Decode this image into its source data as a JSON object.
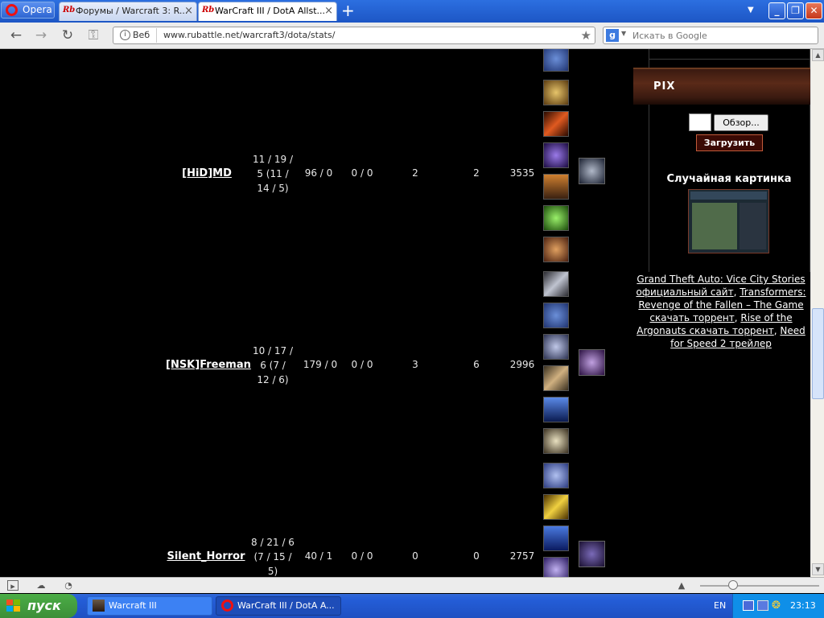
{
  "tabs": {
    "opera_label": "Opera",
    "items": [
      {
        "label": "Форумы / Warcraft 3: R...",
        "state": "inactive"
      },
      {
        "label": "WarCraft III / DotA Allst...",
        "state": "active"
      }
    ],
    "close_glyph": "×",
    "new_tab_glyph": "+"
  },
  "address": {
    "site_badge": "Веб",
    "url": "www.rubattle.net/warcraft3/dota/stats/",
    "search_placeholder": "Искать в Google",
    "search_engine_letter": "g"
  },
  "stats_rows": [
    {
      "player": "[HiD]MD",
      "kda_lines": [
        "11 / 19 /",
        "5 (11 /",
        "14 / 5)"
      ],
      "creeps": "96 / 0",
      "neutrals": "0 / 0",
      "towers": "2",
      "rax": "2",
      "gold": "3535"
    },
    {
      "player": "[NSK]Freeman",
      "kda_lines": [
        "10 / 17 /",
        "6 (7 /",
        "12 / 6)"
      ],
      "creeps": "179 / 0",
      "neutrals": "0 / 0",
      "towers": "3",
      "rax": "6",
      "gold": "2996"
    },
    {
      "player": "Silent_Horror",
      "kda_lines": [
        "8 / 21 / 6",
        "(7 / 15 /",
        "5)"
      ],
      "creeps": "40 / 1",
      "neutrals": "0 / 0",
      "towers": "0",
      "rax": "0",
      "gold": "2757"
    }
  ],
  "sidebar": {
    "pix_title": "PIX",
    "browse_label": "Обзор...",
    "upload_label": "Загрузить",
    "random_title": "Случайная картинка",
    "links": [
      {
        "text": "Grand Theft Auto: Vice City Stories официальный сайт",
        "sep": ", "
      },
      {
        "text": "Transformers: Revenge of the Fallen – The Game скачать торрент",
        "sep": ", "
      },
      {
        "text": "Rise of the Argonauts скачать торрент",
        "sep": ", "
      },
      {
        "text": "Need for Speed 2 трейлер",
        "sep": ""
      }
    ]
  },
  "taskbar": {
    "start_label": "пуск",
    "tasks": [
      {
        "label": "Warcraft III",
        "state": "normal"
      },
      {
        "label": "WarCraft III / DotA A...",
        "state": "pressed"
      }
    ],
    "lang": "EN",
    "clock": "23:13"
  },
  "colors": {
    "opera_red": "#e11111",
    "item_palette": [
      "#3a5fa8",
      "#b08a3a",
      "#c0481a",
      "#4a2a8a",
      "#b86a20",
      "#3c8a2a",
      "#a06030",
      "#707888",
      "#2a4aa0",
      "#5a6a9a",
      "#6a5a3a",
      "#2a5ab8",
      "#b0a070",
      "#5060a0",
      "#c0a030",
      "#3050a0",
      "#6050a0"
    ]
  }
}
